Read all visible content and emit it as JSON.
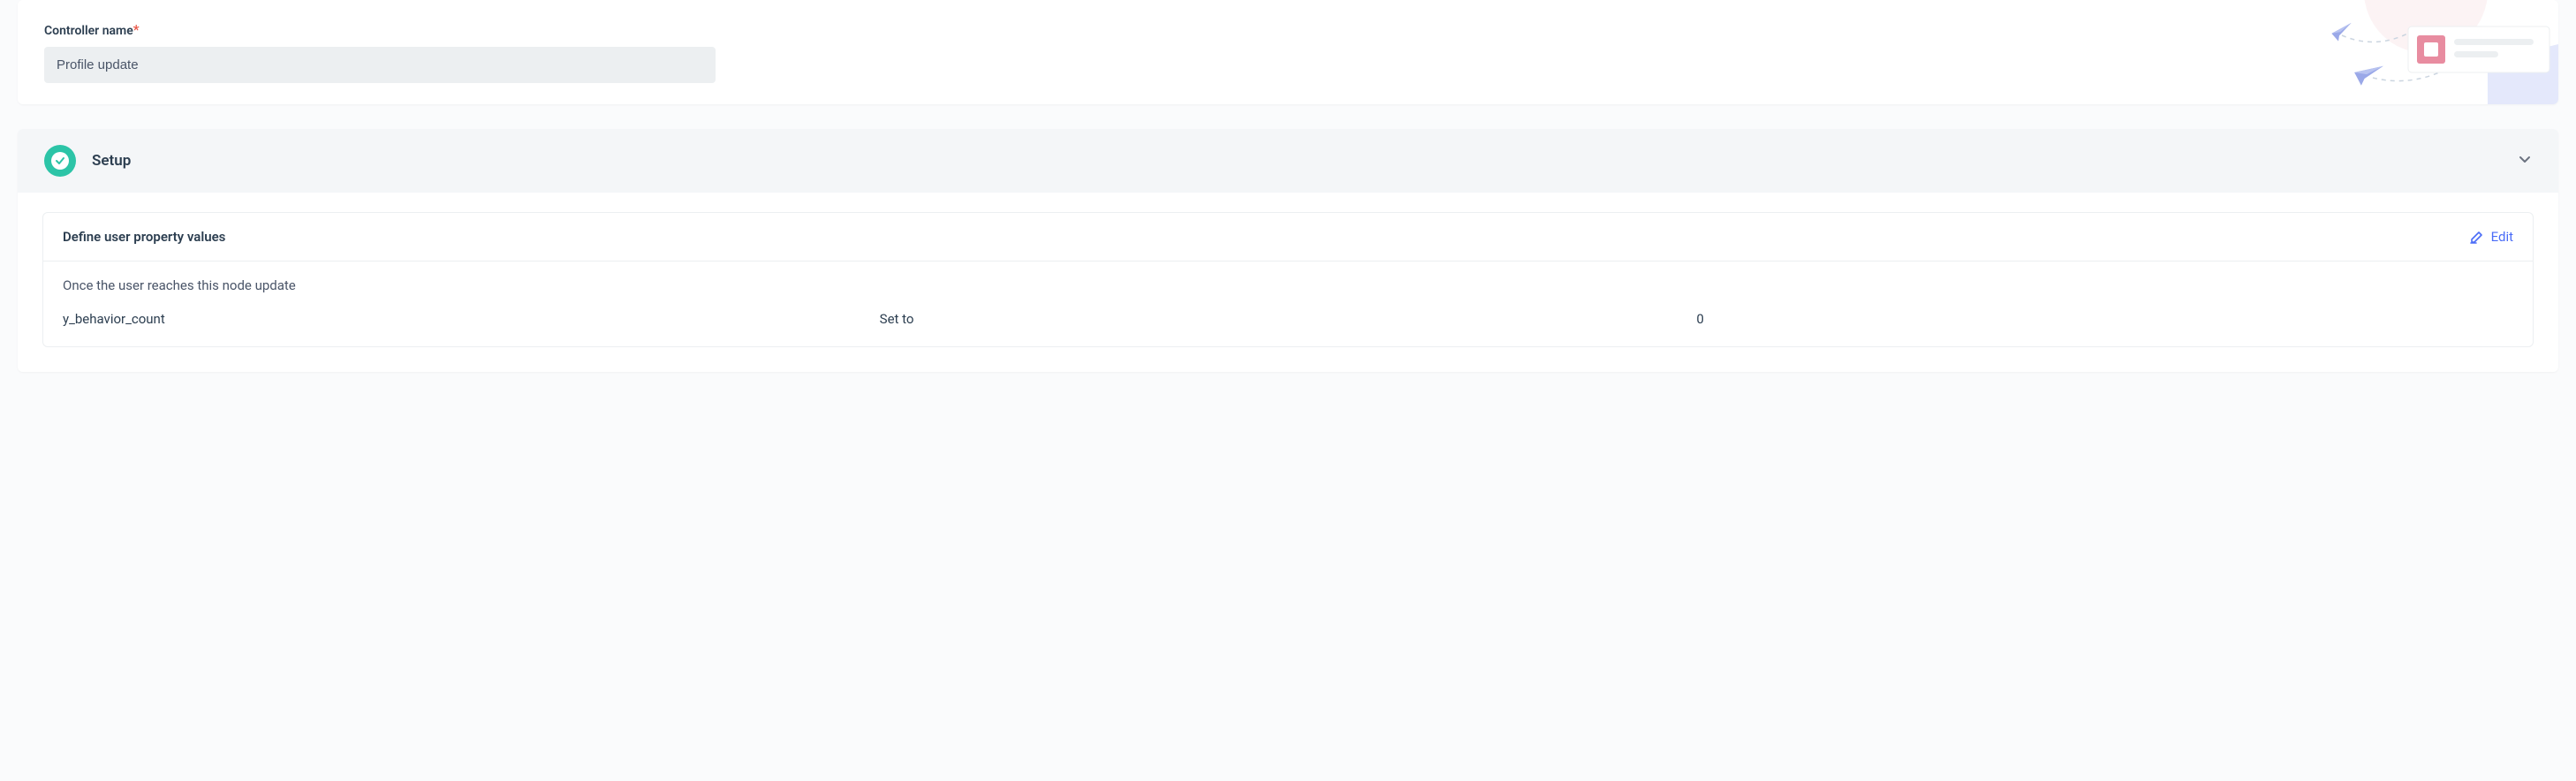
{
  "controller": {
    "label": "Controller name",
    "required_mark": "*",
    "value": "Profile update"
  },
  "setup": {
    "title": "Setup",
    "panel": {
      "title": "Define user property values",
      "edit_label": "Edit",
      "description": "Once the user reaches this node update",
      "rows": [
        {
          "property": "y_behavior_count",
          "operation": "Set to",
          "value": "0"
        }
      ]
    }
  }
}
